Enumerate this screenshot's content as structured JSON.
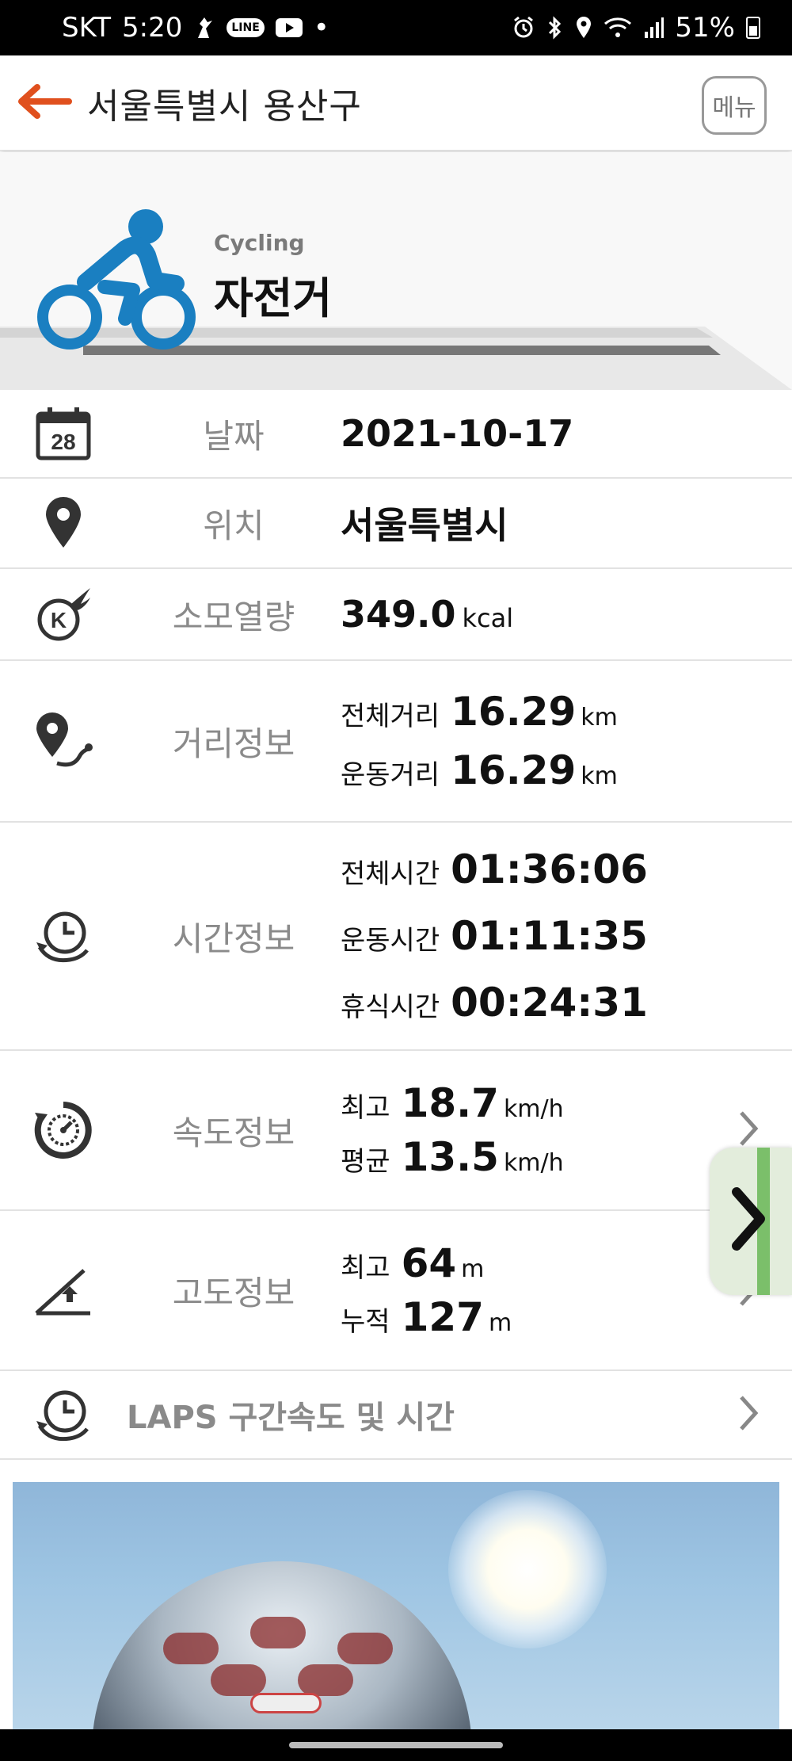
{
  "status_bar": {
    "carrier": "SKT",
    "time": "5:20",
    "battery": "51%",
    "notification_icons": [
      "fitness-icon",
      "line-app-icon",
      "youtube-icon",
      "dot-icon"
    ],
    "system_icons": [
      "alarm-icon",
      "bluetooth-icon",
      "location-icon",
      "wifi-icon",
      "signal-icon",
      "battery-icon"
    ]
  },
  "header": {
    "title": "서울특별시 용산구",
    "menu_label": "메뉴",
    "accent_color": "#e0501e"
  },
  "hero": {
    "subtitle": "Cycling",
    "title": "자전거",
    "icon": "cyclist-icon",
    "icon_color": "#1a7fc1"
  },
  "rows": {
    "date": {
      "label": "날짜",
      "value": "2021-10-17",
      "calendar_day": "28"
    },
    "location": {
      "label": "위치",
      "value": "서울특별시"
    },
    "calories": {
      "label": "소모열량",
      "value": "349.0",
      "unit": "kcal"
    },
    "distance": {
      "label": "거리정보",
      "lines": [
        {
          "label": "전체거리",
          "value": "16.29",
          "unit": "km"
        },
        {
          "label": "운동거리",
          "value": "16.29",
          "unit": "km"
        }
      ]
    },
    "time": {
      "label": "시간정보",
      "lines": [
        {
          "label": "전체시간",
          "value": "01:36:06"
        },
        {
          "label": "운동시간",
          "value": "01:11:35"
        },
        {
          "label": "휴식시간",
          "value": "00:24:31"
        }
      ]
    },
    "speed": {
      "label": "속도정보",
      "lines": [
        {
          "label": "최고",
          "value": "18.7",
          "unit": "km/h"
        },
        {
          "label": "평균",
          "value": "13.5",
          "unit": "km/h"
        }
      ]
    },
    "altitude": {
      "label": "고도정보",
      "lines": [
        {
          "label": "최고",
          "value": "64",
          "unit": "m"
        },
        {
          "label": "누적",
          "value": "127",
          "unit": "m"
        }
      ]
    },
    "laps": {
      "label": "LAPS 구간속도 및 시간"
    }
  }
}
